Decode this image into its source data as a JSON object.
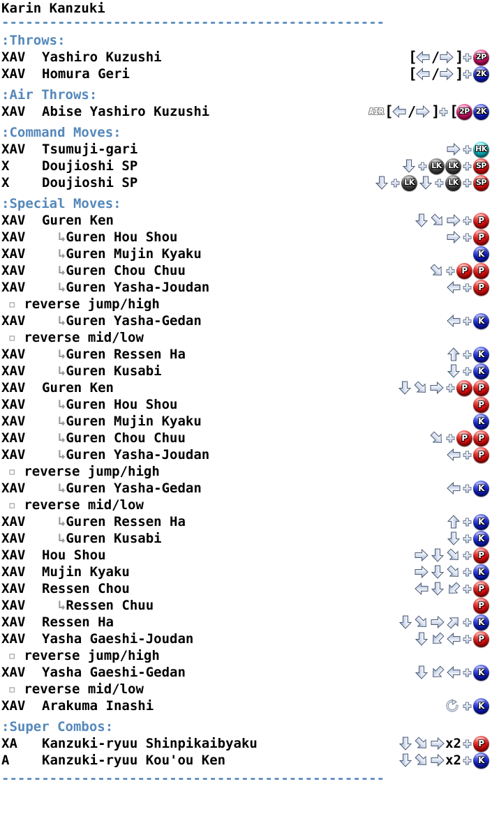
{
  "character": "Karin Kanzuki",
  "divider": "------------------------------------------------",
  "colors": {
    "section_heading": "#5588bb",
    "punch": "#e01010",
    "kick": "#1020d0",
    "super": "#e01010",
    "light_kick": "#4a4a4a",
    "heavy_kick": "#0fc0c8",
    "throw_punch": "#d4106a",
    "throw_kick": "#1020d0",
    "arrow": "#c8d4e8",
    "text": "#000000"
  },
  "sections": [
    {
      "heading": ":Throws:",
      "rows": [
        {
          "type": "move",
          "level": "XAV",
          "name": "Yashiro Kuzushi",
          "cmd": [
            {
              "k": "bracket",
              "t": "["
            },
            {
              "k": "arrow",
              "d": "left"
            },
            {
              "k": "slash",
              "t": "/"
            },
            {
              "k": "arrow",
              "d": "right"
            },
            {
              "k": "bracket",
              "t": "]"
            },
            {
              "k": "plus"
            },
            {
              "k": "btn",
              "t": "2P",
              "style": "2P"
            }
          ]
        },
        {
          "type": "move",
          "level": "XAV",
          "name": "Homura Geri",
          "cmd": [
            {
              "k": "bracket",
              "t": "["
            },
            {
              "k": "arrow",
              "d": "left"
            },
            {
              "k": "slash",
              "t": "/"
            },
            {
              "k": "arrow",
              "d": "right"
            },
            {
              "k": "bracket",
              "t": "]"
            },
            {
              "k": "plus"
            },
            {
              "k": "btn",
              "t": "2K",
              "style": "2K"
            }
          ]
        }
      ]
    },
    {
      "heading": ":Air Throws:",
      "rows": [
        {
          "type": "move",
          "level": "XAV",
          "name": "Abise Yashiro Kuzushi",
          "cmd": [
            {
              "k": "air",
              "t": "AIR"
            },
            {
              "k": "bracket",
              "t": "["
            },
            {
              "k": "arrow",
              "d": "left"
            },
            {
              "k": "slash",
              "t": "/"
            },
            {
              "k": "arrow",
              "d": "right"
            },
            {
              "k": "bracket",
              "t": "]"
            },
            {
              "k": "plus"
            },
            {
              "k": "bracket",
              "t": "["
            },
            {
              "k": "btn",
              "t": "2P",
              "style": "2P"
            },
            {
              "k": "btn",
              "t": "2K",
              "style": "2K"
            }
          ]
        }
      ]
    },
    {
      "heading": ":Command Moves:",
      "rows": [
        {
          "type": "move",
          "level": "XAV",
          "name": "Tsumuji-gari",
          "cmd": [
            {
              "k": "arrow",
              "d": "right"
            },
            {
              "k": "plus"
            },
            {
              "k": "btn",
              "t": "HK",
              "style": "HK"
            }
          ]
        },
        {
          "type": "move",
          "level": "X",
          "name": "Doujioshi SP",
          "cmd": [
            {
              "k": "arrow",
              "d": "down"
            },
            {
              "k": "plus"
            },
            {
              "k": "btn",
              "t": "LK",
              "style": "LK"
            },
            {
              "k": "btn",
              "t": "LK",
              "style": "LK"
            },
            {
              "k": "plus"
            },
            {
              "k": "btn",
              "t": "SP",
              "style": "SP"
            }
          ]
        },
        {
          "type": "move",
          "level": "X",
          "name": "Doujioshi SP",
          "cmd": [
            {
              "k": "arrow",
              "d": "down"
            },
            {
              "k": "plus"
            },
            {
              "k": "btn",
              "t": "LK",
              "style": "LK"
            },
            {
              "k": "arrow",
              "d": "down"
            },
            {
              "k": "plus"
            },
            {
              "k": "btn",
              "t": "LK",
              "style": "LK"
            },
            {
              "k": "plus"
            },
            {
              "k": "btn",
              "t": "SP",
              "style": "SP"
            }
          ]
        }
      ]
    },
    {
      "heading": ":Special Moves:",
      "rows": [
        {
          "type": "move",
          "level": "XAV",
          "name": "Guren Ken",
          "indent": 0,
          "cmd": [
            {
              "k": "arrow",
              "d": "down"
            },
            {
              "k": "arrow",
              "d": "downright"
            },
            {
              "k": "arrow",
              "d": "right"
            },
            {
              "k": "plus"
            },
            {
              "k": "btn",
              "t": "P",
              "style": "P"
            }
          ]
        },
        {
          "type": "move",
          "level": "XAV",
          "name": "Guren Hou Shou",
          "indent": 1,
          "cmd": [
            {
              "k": "arrow",
              "d": "right"
            },
            {
              "k": "plus"
            },
            {
              "k": "btn",
              "t": "P",
              "style": "P"
            }
          ]
        },
        {
          "type": "move",
          "level": "XAV",
          "name": "Guren Mujin Kyaku",
          "indent": 1,
          "cmd": [
            {
              "k": "btn",
              "t": "K",
              "style": "K"
            }
          ]
        },
        {
          "type": "move",
          "level": "XAV",
          "name": "Guren Chou Chuu",
          "indent": 1,
          "cmd": [
            {
              "k": "arrow",
              "d": "downright"
            },
            {
              "k": "plus"
            },
            {
              "k": "btn",
              "t": "P",
              "style": "P"
            },
            {
              "k": "btn",
              "t": "P",
              "style": "P"
            }
          ]
        },
        {
          "type": "move",
          "level": "XAV",
          "name": "Guren Yasha-Joudan",
          "indent": 1,
          "cmd": [
            {
              "k": "arrow",
              "d": "left"
            },
            {
              "k": "plus"
            },
            {
              "k": "btn",
              "t": "P",
              "style": "P"
            }
          ]
        },
        {
          "type": "note",
          "name": "reverse jump/high",
          "cmd": []
        },
        {
          "type": "move",
          "level": "XAV",
          "name": "Guren Yasha-Gedan",
          "indent": 1,
          "cmd": [
            {
              "k": "arrow",
              "d": "left"
            },
            {
              "k": "plus"
            },
            {
              "k": "btn",
              "t": "K",
              "style": "K"
            }
          ]
        },
        {
          "type": "note",
          "name": "reverse mid/low",
          "cmd": []
        },
        {
          "type": "move",
          "level": "XAV",
          "name": "Guren Ressen Ha",
          "indent": 1,
          "cmd": [
            {
              "k": "arrow",
              "d": "up"
            },
            {
              "k": "plus"
            },
            {
              "k": "btn",
              "t": "K",
              "style": "K"
            }
          ]
        },
        {
          "type": "move",
          "level": "XAV",
          "name": "Guren Kusabi",
          "indent": 1,
          "cmd": [
            {
              "k": "arrow",
              "d": "down"
            },
            {
              "k": "plus"
            },
            {
              "k": "btn",
              "t": "K",
              "style": "K"
            }
          ]
        },
        {
          "type": "move",
          "level": "XAV",
          "name": "Guren Ken",
          "indent": 0,
          "cmd": [
            {
              "k": "arrow",
              "d": "down"
            },
            {
              "k": "arrow",
              "d": "downright"
            },
            {
              "k": "arrow",
              "d": "right"
            },
            {
              "k": "plus"
            },
            {
              "k": "btn",
              "t": "P",
              "style": "P"
            },
            {
              "k": "btn",
              "t": "P",
              "style": "P"
            }
          ]
        },
        {
          "type": "move",
          "level": "XAV",
          "name": "Guren Hou Shou",
          "indent": 1,
          "cmd": [
            {
              "k": "btn",
              "t": "P",
              "style": "P"
            }
          ]
        },
        {
          "type": "move",
          "level": "XAV",
          "name": "Guren Mujin Kyaku",
          "indent": 1,
          "cmd": [
            {
              "k": "btn",
              "t": "K",
              "style": "K"
            }
          ]
        },
        {
          "type": "move",
          "level": "XAV",
          "name": "Guren Chou Chuu",
          "indent": 1,
          "cmd": [
            {
              "k": "arrow",
              "d": "downright"
            },
            {
              "k": "plus"
            },
            {
              "k": "btn",
              "t": "P",
              "style": "P"
            },
            {
              "k": "btn",
              "t": "P",
              "style": "P"
            }
          ]
        },
        {
          "type": "move",
          "level": "XAV",
          "name": "Guren Yasha-Joudan",
          "indent": 1,
          "cmd": [
            {
              "k": "arrow",
              "d": "left"
            },
            {
              "k": "plus"
            },
            {
              "k": "btn",
              "t": "P",
              "style": "P"
            }
          ]
        },
        {
          "type": "note",
          "name": "reverse jump/high",
          "cmd": []
        },
        {
          "type": "move",
          "level": "XAV",
          "name": "Guren Yasha-Gedan",
          "indent": 1,
          "cmd": [
            {
              "k": "arrow",
              "d": "left"
            },
            {
              "k": "plus"
            },
            {
              "k": "btn",
              "t": "K",
              "style": "K"
            }
          ]
        },
        {
          "type": "note",
          "name": "reverse mid/low",
          "cmd": []
        },
        {
          "type": "move",
          "level": "XAV",
          "name": "Guren Ressen Ha",
          "indent": 1,
          "cmd": [
            {
              "k": "arrow",
              "d": "up"
            },
            {
              "k": "plus"
            },
            {
              "k": "btn",
              "t": "K",
              "style": "K"
            }
          ]
        },
        {
          "type": "move",
          "level": "XAV",
          "name": "Guren Kusabi",
          "indent": 1,
          "cmd": [
            {
              "k": "arrow",
              "d": "down"
            },
            {
              "k": "plus"
            },
            {
              "k": "btn",
              "t": "K",
              "style": "K"
            }
          ]
        },
        {
          "type": "move",
          "level": "XAV",
          "name": "Hou Shou",
          "indent": 0,
          "cmd": [
            {
              "k": "arrow",
              "d": "right"
            },
            {
              "k": "arrow",
              "d": "down"
            },
            {
              "k": "arrow",
              "d": "downright"
            },
            {
              "k": "plus"
            },
            {
              "k": "btn",
              "t": "P",
              "style": "P"
            }
          ]
        },
        {
          "type": "move",
          "level": "XAV",
          "name": "Mujin Kyaku",
          "indent": 0,
          "cmd": [
            {
              "k": "arrow",
              "d": "right"
            },
            {
              "k": "arrow",
              "d": "down"
            },
            {
              "k": "arrow",
              "d": "downright"
            },
            {
              "k": "plus"
            },
            {
              "k": "btn",
              "t": "K",
              "style": "K"
            }
          ]
        },
        {
          "type": "move",
          "level": "XAV",
          "name": "Ressen Chou",
          "indent": 0,
          "cmd": [
            {
              "k": "arrow",
              "d": "left"
            },
            {
              "k": "arrow",
              "d": "down"
            },
            {
              "k": "arrow",
              "d": "downleft"
            },
            {
              "k": "plus"
            },
            {
              "k": "btn",
              "t": "P",
              "style": "P"
            }
          ]
        },
        {
          "type": "move",
          "level": "XAV",
          "name": "Ressen Chuu",
          "indent": 1,
          "cmd": [
            {
              "k": "btn",
              "t": "P",
              "style": "P"
            }
          ]
        },
        {
          "type": "move",
          "level": "XAV",
          "name": "Ressen Ha",
          "indent": 0,
          "cmd": [
            {
              "k": "arrow",
              "d": "down"
            },
            {
              "k": "arrow",
              "d": "downright"
            },
            {
              "k": "arrow",
              "d": "right"
            },
            {
              "k": "arrow",
              "d": "upright"
            },
            {
              "k": "plus"
            },
            {
              "k": "btn",
              "t": "K",
              "style": "K"
            }
          ]
        },
        {
          "type": "move",
          "level": "XAV",
          "name": "Yasha Gaeshi-Joudan",
          "indent": 0,
          "cmd": [
            {
              "k": "arrow",
              "d": "down"
            },
            {
              "k": "arrow",
              "d": "downleft"
            },
            {
              "k": "arrow",
              "d": "left"
            },
            {
              "k": "plus"
            },
            {
              "k": "btn",
              "t": "P",
              "style": "P"
            }
          ]
        },
        {
          "type": "note",
          "name": "reverse jump/high",
          "cmd": []
        },
        {
          "type": "move",
          "level": "XAV",
          "name": "Yasha Gaeshi-Gedan",
          "indent": 0,
          "cmd": [
            {
              "k": "arrow",
              "d": "down"
            },
            {
              "k": "arrow",
              "d": "downleft"
            },
            {
              "k": "arrow",
              "d": "left"
            },
            {
              "k": "plus"
            },
            {
              "k": "btn",
              "t": "K",
              "style": "K"
            }
          ]
        },
        {
          "type": "note",
          "name": "reverse mid/low",
          "cmd": []
        },
        {
          "type": "move",
          "level": "XAV",
          "name": "Arakuma Inashi",
          "indent": 0,
          "cmd": [
            {
              "k": "rot"
            },
            {
              "k": "plus"
            },
            {
              "k": "btn",
              "t": "K",
              "style": "K"
            }
          ]
        }
      ]
    },
    {
      "heading": ":Super Combos:",
      "rows": [
        {
          "type": "move",
          "level": "XA",
          "name": "Kanzuki-ryuu Shinpikaibyaku",
          "indent": 0,
          "cmd": [
            {
              "k": "arrow",
              "d": "down"
            },
            {
              "k": "arrow",
              "d": "downright"
            },
            {
              "k": "arrow",
              "d": "right"
            },
            {
              "k": "x2",
              "t": "x2"
            },
            {
              "k": "plus"
            },
            {
              "k": "btn",
              "t": "P",
              "style": "P"
            }
          ]
        },
        {
          "type": "move",
          "level": "A",
          "name": "Kanzuki-ryuu Kou'ou Ken",
          "indent": 0,
          "cmd": [
            {
              "k": "arrow",
              "d": "down"
            },
            {
              "k": "arrow",
              "d": "downright"
            },
            {
              "k": "arrow",
              "d": "right"
            },
            {
              "k": "x2",
              "t": "x2"
            },
            {
              "k": "plus"
            },
            {
              "k": "btn",
              "t": "K",
              "style": "K"
            }
          ]
        }
      ]
    }
  ],
  "glyphs": {
    "sub_arrow": "↳",
    "note_bullet": "▫"
  }
}
